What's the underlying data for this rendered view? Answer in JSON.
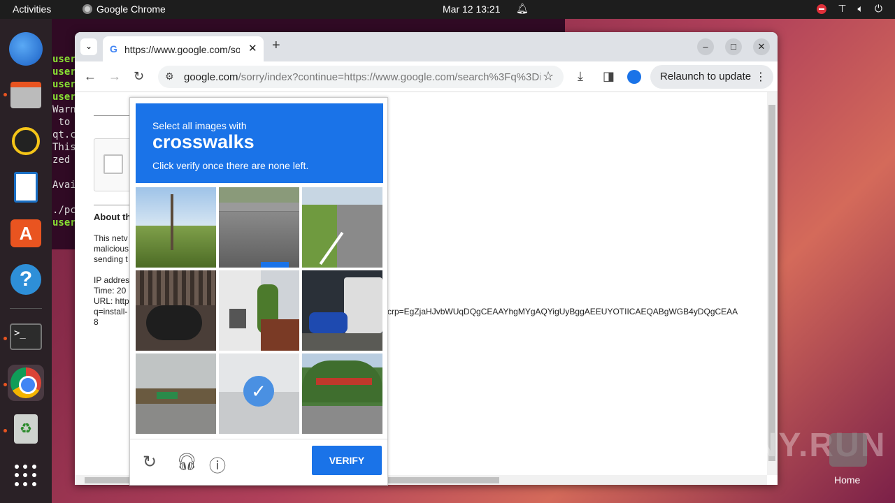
{
  "topbar": {
    "activities": "Activities",
    "app_name": "Google Chrome",
    "clock": "Mar 12  13:21"
  },
  "dock": {
    "items": [
      "thunderbird",
      "files",
      "rhythmbox",
      "libreoffice-writer",
      "app-center",
      "help",
      "terminal",
      "google-chrome",
      "trash",
      "show-apps"
    ]
  },
  "terminal": {
    "lines": [
      {
        "text": "user",
        "green": true
      },
      {
        "text": "user",
        "green": true
      },
      {
        "text": "user",
        "green": true
      },
      {
        "text": "user",
        "green": true
      },
      {
        "text": "Warn",
        "green": false
      },
      {
        "text": " to",
        "green": false
      },
      {
        "text": "qt.c",
        "green": false
      },
      {
        "text": "This",
        "green": false
      },
      {
        "text": "zed",
        "green": false
      },
      {
        "text": "",
        "green": false
      },
      {
        "text": "Avai",
        "green": false
      },
      {
        "text": "",
        "green": false
      },
      {
        "text": "./pc",
        "green": false
      },
      {
        "text": "user",
        "green": true
      }
    ]
  },
  "browser": {
    "tab_title": "https://www.google.com/sorry/index",
    "url_host": "google.com",
    "url_path": "/sorry/index?continue=https://www.google.com/search%3Fq%3Di...",
    "relaunch_label": "Relaunch to update"
  },
  "page": {
    "about_heading": "About th",
    "para1": [
      "This netv",
      "malicious",
      "sending t"
    ],
    "ip_line": "IP addres",
    "time_line": "Time: 20",
    "url_line": "URL: http",
    "q_line": "q=install-",
    "eight": "8",
    "crp_line": "crp=EgZjaHJvbWUqDQgCEAAYhgMYgAQYigUyBggAEEUYOTIICAEQABgWGB4yDQgCEAA"
  },
  "captcha": {
    "line1": "Select all images with",
    "keyword": "crosswalks",
    "line3": "Click verify once there are none left.",
    "verify_label": "VERIFY",
    "tiles": [
      {
        "name": "tree-grass",
        "selected": false
      },
      {
        "name": "highway-overpass",
        "selected": false
      },
      {
        "name": "road-grass",
        "selected": false
      },
      {
        "name": "motorcycle-fence",
        "selected": false
      },
      {
        "name": "house-porch",
        "selected": false
      },
      {
        "name": "scooter-van",
        "selected": false
      },
      {
        "name": "bridge-traffic",
        "selected": false
      },
      {
        "name": "street-faded",
        "selected": true
      },
      {
        "name": "tunnel-highway",
        "selected": false
      }
    ]
  },
  "desktop": {
    "watermark": "ANY.RUN",
    "home_label": "Home"
  },
  "colors": {
    "accent": "#1a73e8",
    "ubuntu_orange": "#e95420",
    "terminal_bg": "#300a24"
  }
}
